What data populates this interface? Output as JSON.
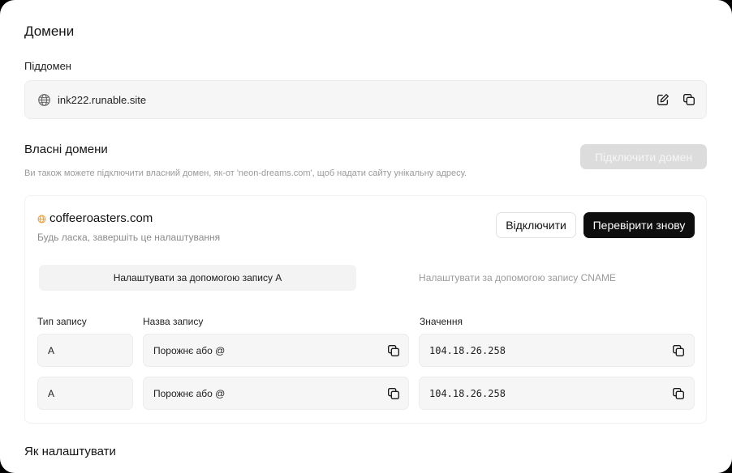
{
  "page": {
    "title": "Домени"
  },
  "subdomain": {
    "label": "Піддомен",
    "value": "ink222.runable.site",
    "icons": {
      "globe": "globe-icon",
      "edit": "edit-icon",
      "copy": "copy-icon"
    }
  },
  "custom_domains": {
    "title": "Власні домени",
    "connect_label": "Підключити домен",
    "hint": "Ви також можете підключити власний домен, як-от 'neon-dreams.com', щоб надати сайту унікальну адресу."
  },
  "domain_card": {
    "name": "coffeeroasters.com",
    "note": "Будь ласка, завершіть це налаштування",
    "disconnect_label": "Відключити",
    "recheck_label": "Перевірити знову",
    "tabs": [
      {
        "label": "Налаштувати за допомогою запису A",
        "active": true
      },
      {
        "label": "Налаштувати за допомогою запису CNAME",
        "active": false
      }
    ],
    "columns": [
      "Тип запису",
      "Назва запису",
      "Значення"
    ],
    "records": [
      {
        "type": "A",
        "name": "Порожнє або @",
        "value": "104.18.26.258"
      },
      {
        "type": "A",
        "name": "Порожнє або @",
        "value": "104.18.26.258"
      }
    ]
  },
  "footer": {
    "how_title": "Як налаштувати"
  },
  "colors": {
    "accent_globe": "#e7a343",
    "primary_button": "#0e0e0e",
    "disabled_button": "#dcdcdc"
  }
}
